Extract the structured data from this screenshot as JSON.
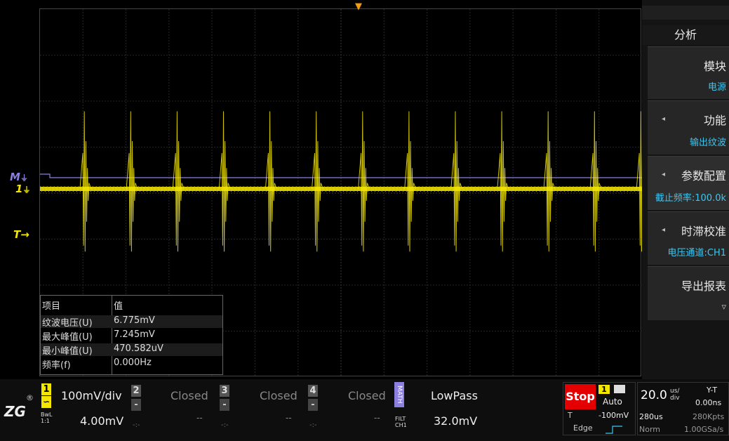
{
  "trigger_marker": "▼",
  "markers": {
    "math": "M",
    "ch1": "1",
    "trigger": "T"
  },
  "measure_table": {
    "header": [
      "项目",
      "值"
    ],
    "rows": [
      [
        "纹波电压(U)",
        "6.775mV"
      ],
      [
        "最大峰值(U)",
        "7.245mV"
      ],
      [
        "最小峰值(U)",
        "470.582uV"
      ],
      [
        "频率(f)",
        "0.000Hz"
      ]
    ]
  },
  "menu": {
    "title": "分析",
    "items": [
      {
        "label": "模块",
        "value": "电源"
      },
      {
        "label": "功能",
        "value": "输出纹波"
      },
      {
        "label": "参数配置",
        "value": "截止频率:100.0k"
      },
      {
        "label": "时滞校准",
        "value": "电压通道:CH1"
      },
      {
        "label": "导出报表",
        "value": "▿"
      }
    ]
  },
  "channels": {
    "ch1": {
      "num": "1",
      "scale": "100mV/div",
      "offset": "4.00mV",
      "coupling": "∽",
      "bw": "BwL",
      "probe": "1:1"
    },
    "ch2": {
      "num": "2",
      "state": "Closed",
      "offset": "--",
      "minus": "-",
      "dash": "-:-"
    },
    "ch3": {
      "num": "3",
      "state": "Closed",
      "offset": "--",
      "minus": "-",
      "dash": "-:-"
    },
    "ch4": {
      "num": "4",
      "state": "Closed",
      "offset": "--",
      "minus": "-",
      "dash": "-:-"
    },
    "math": {
      "label": "MATH",
      "filter": "LowPass",
      "value": "32.0mV",
      "filt": "FILT",
      "src": "CH1"
    }
  },
  "run": {
    "state": "Stop",
    "trig_ch": "1",
    "mode": "Auto",
    "t_label": "T",
    "level": "-100mV",
    "type": "Edge"
  },
  "timebase": {
    "value": "20.0",
    "unit_top": "us/",
    "unit_bottom": "div",
    "window": "280us",
    "pts": "280Kpts",
    "mode": "Norm",
    "rate": "1.00GSa/s",
    "yt": "Y-T",
    "delay": "0.00ns"
  },
  "logo": {
    "text": "ZG",
    "reg": "®"
  },
  "colors": {
    "ch1": "#f3e600",
    "math": "#8b7fe0",
    "stop": "#e40000",
    "accent": "#3ec6f0",
    "trigger": "#f39c12"
  }
}
